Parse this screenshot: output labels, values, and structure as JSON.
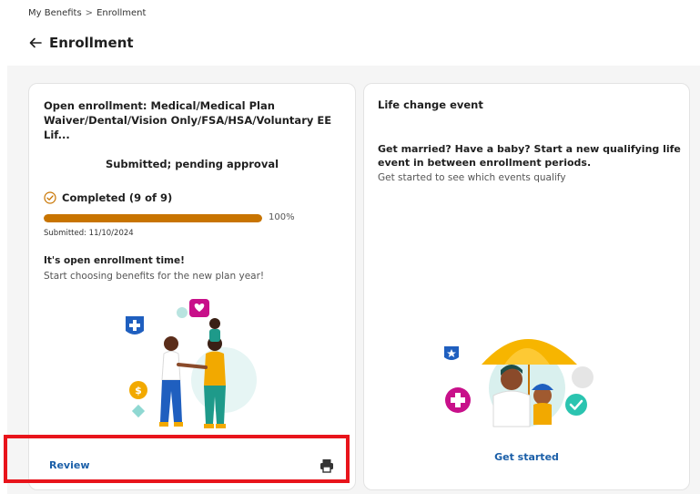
{
  "breadcrumb": {
    "root": "My Benefits",
    "separator": ">",
    "current": "Enrollment"
  },
  "page": {
    "title": "Enrollment"
  },
  "enrollment_card": {
    "title": "Open enrollment: Medical/Medical Plan Waiver/Dental/Vision Only/FSA/HSA/Voluntary EE Lif...",
    "status": "Submitted; pending approval",
    "completed_label": "Completed (9 of 9)",
    "progress_fraction": 1.0,
    "progress_text": "100%",
    "submitted": "Submitted: 11/10/2024",
    "promo_heading": "It's open enrollment time!",
    "promo_sub": "Start choosing benefits for the new plan year!",
    "review_label": "Review"
  },
  "life_event_card": {
    "title": "Life change event",
    "question": "Get married? Have a baby? Start a new qualifying life event in between enrollment periods.",
    "sub": "Get started to see which events qualify",
    "cta_label": "Get started"
  },
  "colors": {
    "accent": "#c87400",
    "link": "#1b5fa8",
    "highlight": "#e8141b",
    "panel_bg": "#f5f5f5"
  },
  "icons": [
    "back-arrow-icon",
    "check-circle-icon",
    "printer-icon"
  ]
}
